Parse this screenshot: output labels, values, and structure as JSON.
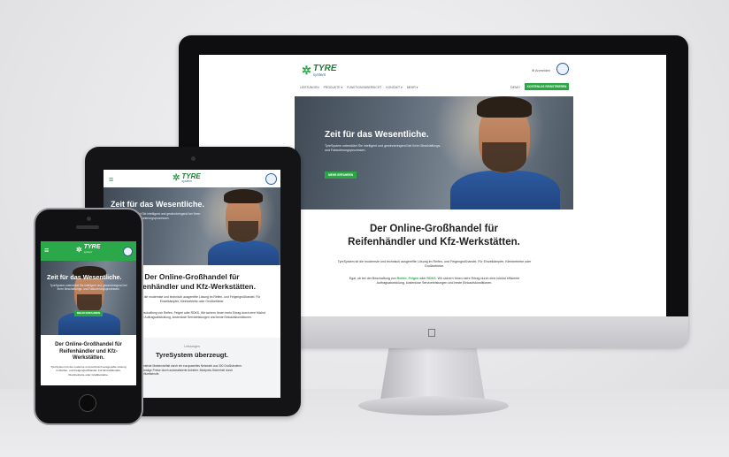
{
  "brand": {
    "logo_name": "TYRE",
    "logo_sub": "system"
  },
  "desktop": {
    "login": "⊕ Anmelden",
    "nav": [
      "LEISTUNGEN",
      "PRODUKTE ▾",
      "FUNKTIONSÜBERSICHT",
      "KONTAKT ▾",
      "MEHR ▾"
    ],
    "demo_button": "DEMO",
    "register_button": "KOSTENLOS REGISTRIEREN",
    "hero_title": "Zeit für das Wesentliche.",
    "hero_text": "TyreSystem unterstützt Sie intelligent und gewinnbringend bei Ihren Beschaffungs- und Fakturierungsprozessen.",
    "hero_button": "MEHR ERFAHREN",
    "headline_1": "Der Online-Großhandel für",
    "headline_2": "Reifenhändler und Kfz-Werkstätten.",
    "para_1": "TyreSystem ist die modernste und technisch ausgereifte Lösung im Reifen- und Felgengroßhandel. Für Einzelkämpfer, Kleinbetriebe oder Großbetriebe.",
    "para_2_pre": "Egal, ob bei der Beschaffung von ",
    "para_2_k1": "Reifen",
    "para_2_mid1": ", ",
    "para_2_k2": "Felgen",
    "para_2_mid2": " oder ",
    "para_2_k3": "RDKS",
    "para_2_post": ". Wir sichern Ihnen mehr Ertrag durch eine höchst effiziente Auftragsabwicklung, kostenlose Serviceleistungen und beste Einkaufskonditionen."
  },
  "tablet": {
    "hero_title": "Zeit für das Wesentliche.",
    "hero_text": "TyreSystem unterstützt Sie intelligent und gewinnbringend bei Ihren Beschaffungs- und Fakturierungsprozessen.",
    "hero_button": "MEHR ERFAHREN",
    "headline_1": "Der Online-Großhandel für",
    "headline_2": "Reifenhändler und Kfz-Werkstätten.",
    "para_1": "TyreSystem ist die modernste und technisch ausgereifte Lösung im Reifen- und Felgengroßhandel. Für Einzelkämpfer, Kleinbetriebe oder Großbetriebe.",
    "para_2": "Egal, ob bei der Beschaffung von Reifen, Felgen oder RDKS. Wir sichern Ihnen mehr Ertrag durch eine höchst effiziente Auftragsabwicklung, kostenlose Servicleistungen und beste Einkaufskonditionen.",
    "eyebrow": "Leistungen",
    "section_title": "TyreSystem überzeugt.",
    "bullets": "Breiteste Markenvielfalt durch ein europaweites Netzwerk aus 300 Großhändlern. Günstige Preise durch automatisierte Anbieter. Bestpreis-Sicherheit durch Echtzeitabrufe."
  },
  "phone": {
    "hero_title": "Zeit für das Wesentliche.",
    "hero_text": "TyreSystem unterstützt Sie intelligent und gewinnbringend bei Ihren Beschaffungs- und Fakturierungsprozessen.",
    "hero_button": "MEHR ERFAHREN",
    "headline": "Der Online-Großhandel für Reifenhändler und Kfz-Werkstätten.",
    "para": "TyreSystem ist die moderne und technisch ausgereifte Lösung im Reifen- und Felgengroßhandel. Für Einzelkämpfer, Kleinbetriebe oder Großbetriebe."
  },
  "colors": {
    "accent": "#28a745",
    "brand_blue": "#2b5fa6",
    "worker_shirt": "#2c5aa0"
  },
  "icons": [
    "apple-logo-icon",
    "hamburger-menu-icon",
    "certificate-seal-icon",
    "tire-logo-icon"
  ]
}
